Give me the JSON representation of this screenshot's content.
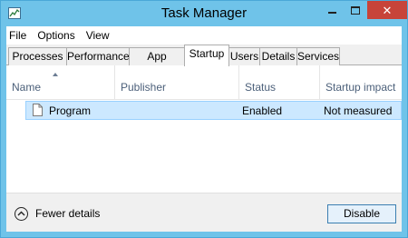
{
  "window": {
    "title": "Task Manager",
    "controls": {
      "minimize": "minimize",
      "maximize": "maximize",
      "close": "✕"
    }
  },
  "menu": [
    "File",
    "Options",
    "View"
  ],
  "tabs": [
    {
      "label": "Processes",
      "active": false
    },
    {
      "label": "Performance",
      "active": false
    },
    {
      "label": "App history",
      "active": false
    },
    {
      "label": "Startup",
      "active": true
    },
    {
      "label": "Users",
      "active": false
    },
    {
      "label": "Details",
      "active": false
    },
    {
      "label": "Services",
      "active": false
    }
  ],
  "table": {
    "columns": [
      "Name",
      "Publisher",
      "Status",
      "Startup impact"
    ],
    "sort_column": "Name",
    "sort_direction": "ascending",
    "rows": [
      {
        "name": "Program",
        "publisher": "",
        "status": "Enabled",
        "impact": "Not measured",
        "selected": true
      }
    ]
  },
  "footer": {
    "fewer_details": "Fewer details",
    "disable": "Disable"
  },
  "colors": {
    "titlebar": "#6fc3e9",
    "close_button": "#c7443a",
    "selection": "#cce8ff",
    "header_text": "#4c607a"
  },
  "icons": {
    "app": "task-manager-icon",
    "row": "document-icon",
    "fewer": "chevron-up-circle-icon"
  }
}
